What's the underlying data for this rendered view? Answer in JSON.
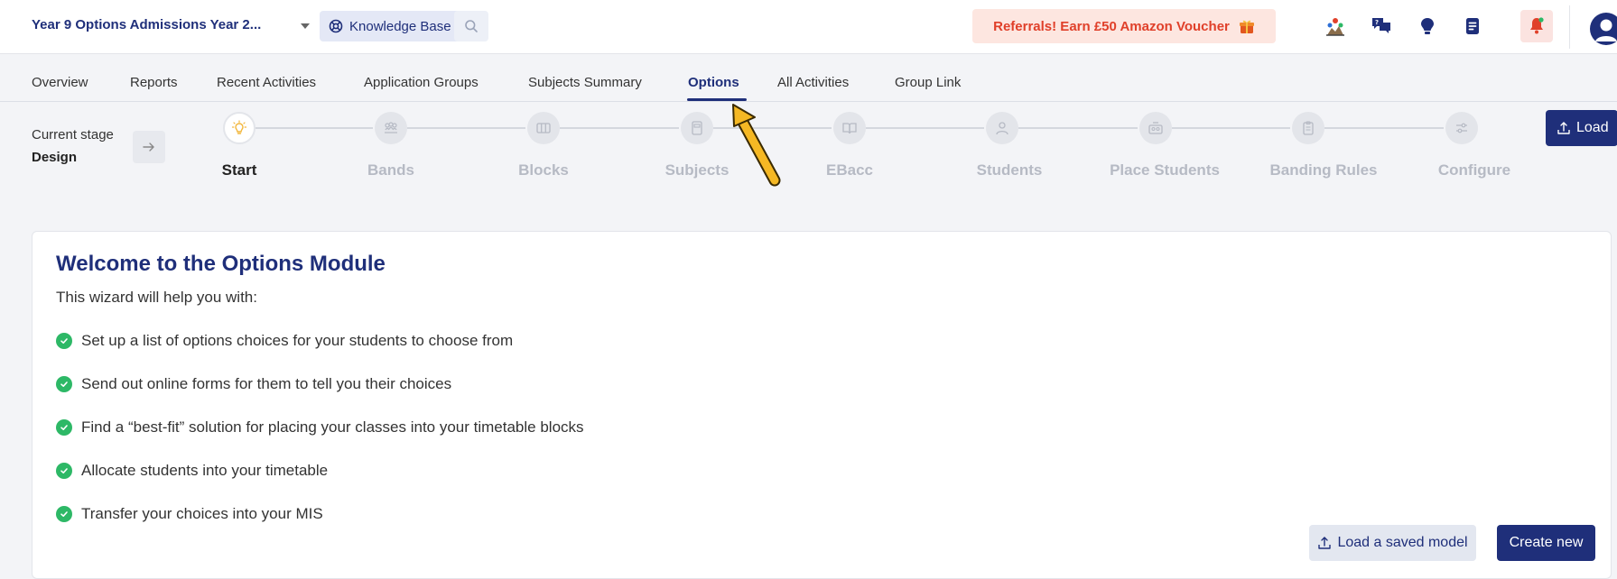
{
  "topbar": {
    "context_title": "Year 9 Options Admissions Year 2...",
    "knowledge_base_label": "Knowledge Base",
    "referral_label": "Referrals! Earn £50 Amazon Voucher",
    "icons": [
      "search-icon",
      "gift-icon",
      "community-icon",
      "chat-icon",
      "lightbulb-icon",
      "notes-icon",
      "bell-icon",
      "user-avatar-icon"
    ],
    "colors": {
      "brand": "#1f2f7a",
      "referral_text": "#e0402a",
      "referral_bg": "#fde6e0"
    }
  },
  "tabs": [
    {
      "label": "Overview"
    },
    {
      "label": "Reports"
    },
    {
      "label": "Recent Activities"
    },
    {
      "label": "Application Groups"
    },
    {
      "label": "Subjects Summary"
    },
    {
      "label": "Options",
      "active": true
    },
    {
      "label": "All Activities"
    },
    {
      "label": "Group Link"
    }
  ],
  "stage": {
    "current_label": "Current stage",
    "current_value": "Design"
  },
  "steps": [
    {
      "label": "Start",
      "current": true
    },
    {
      "label": "Bands"
    },
    {
      "label": "Blocks"
    },
    {
      "label": "Subjects"
    },
    {
      "label": "EBacc"
    },
    {
      "label": "Students"
    },
    {
      "label": "Place Students"
    },
    {
      "label": "Banding Rules"
    },
    {
      "label": "Configure"
    }
  ],
  "load_button_label": "Load",
  "welcome": {
    "title": "Welcome to the Options Module",
    "intro": "This wizard will help you with:",
    "bullets": [
      "Set up a list of options choices for your students to choose from",
      "Send out online forms for them to tell you their choices",
      "Find a “best-fit” solution for placing your classes into your timetable blocks",
      "Allocate students into your timetable",
      "Transfer your choices into your MIS"
    ],
    "load_saved_label": "Load a saved model",
    "create_new_label": "Create new"
  }
}
